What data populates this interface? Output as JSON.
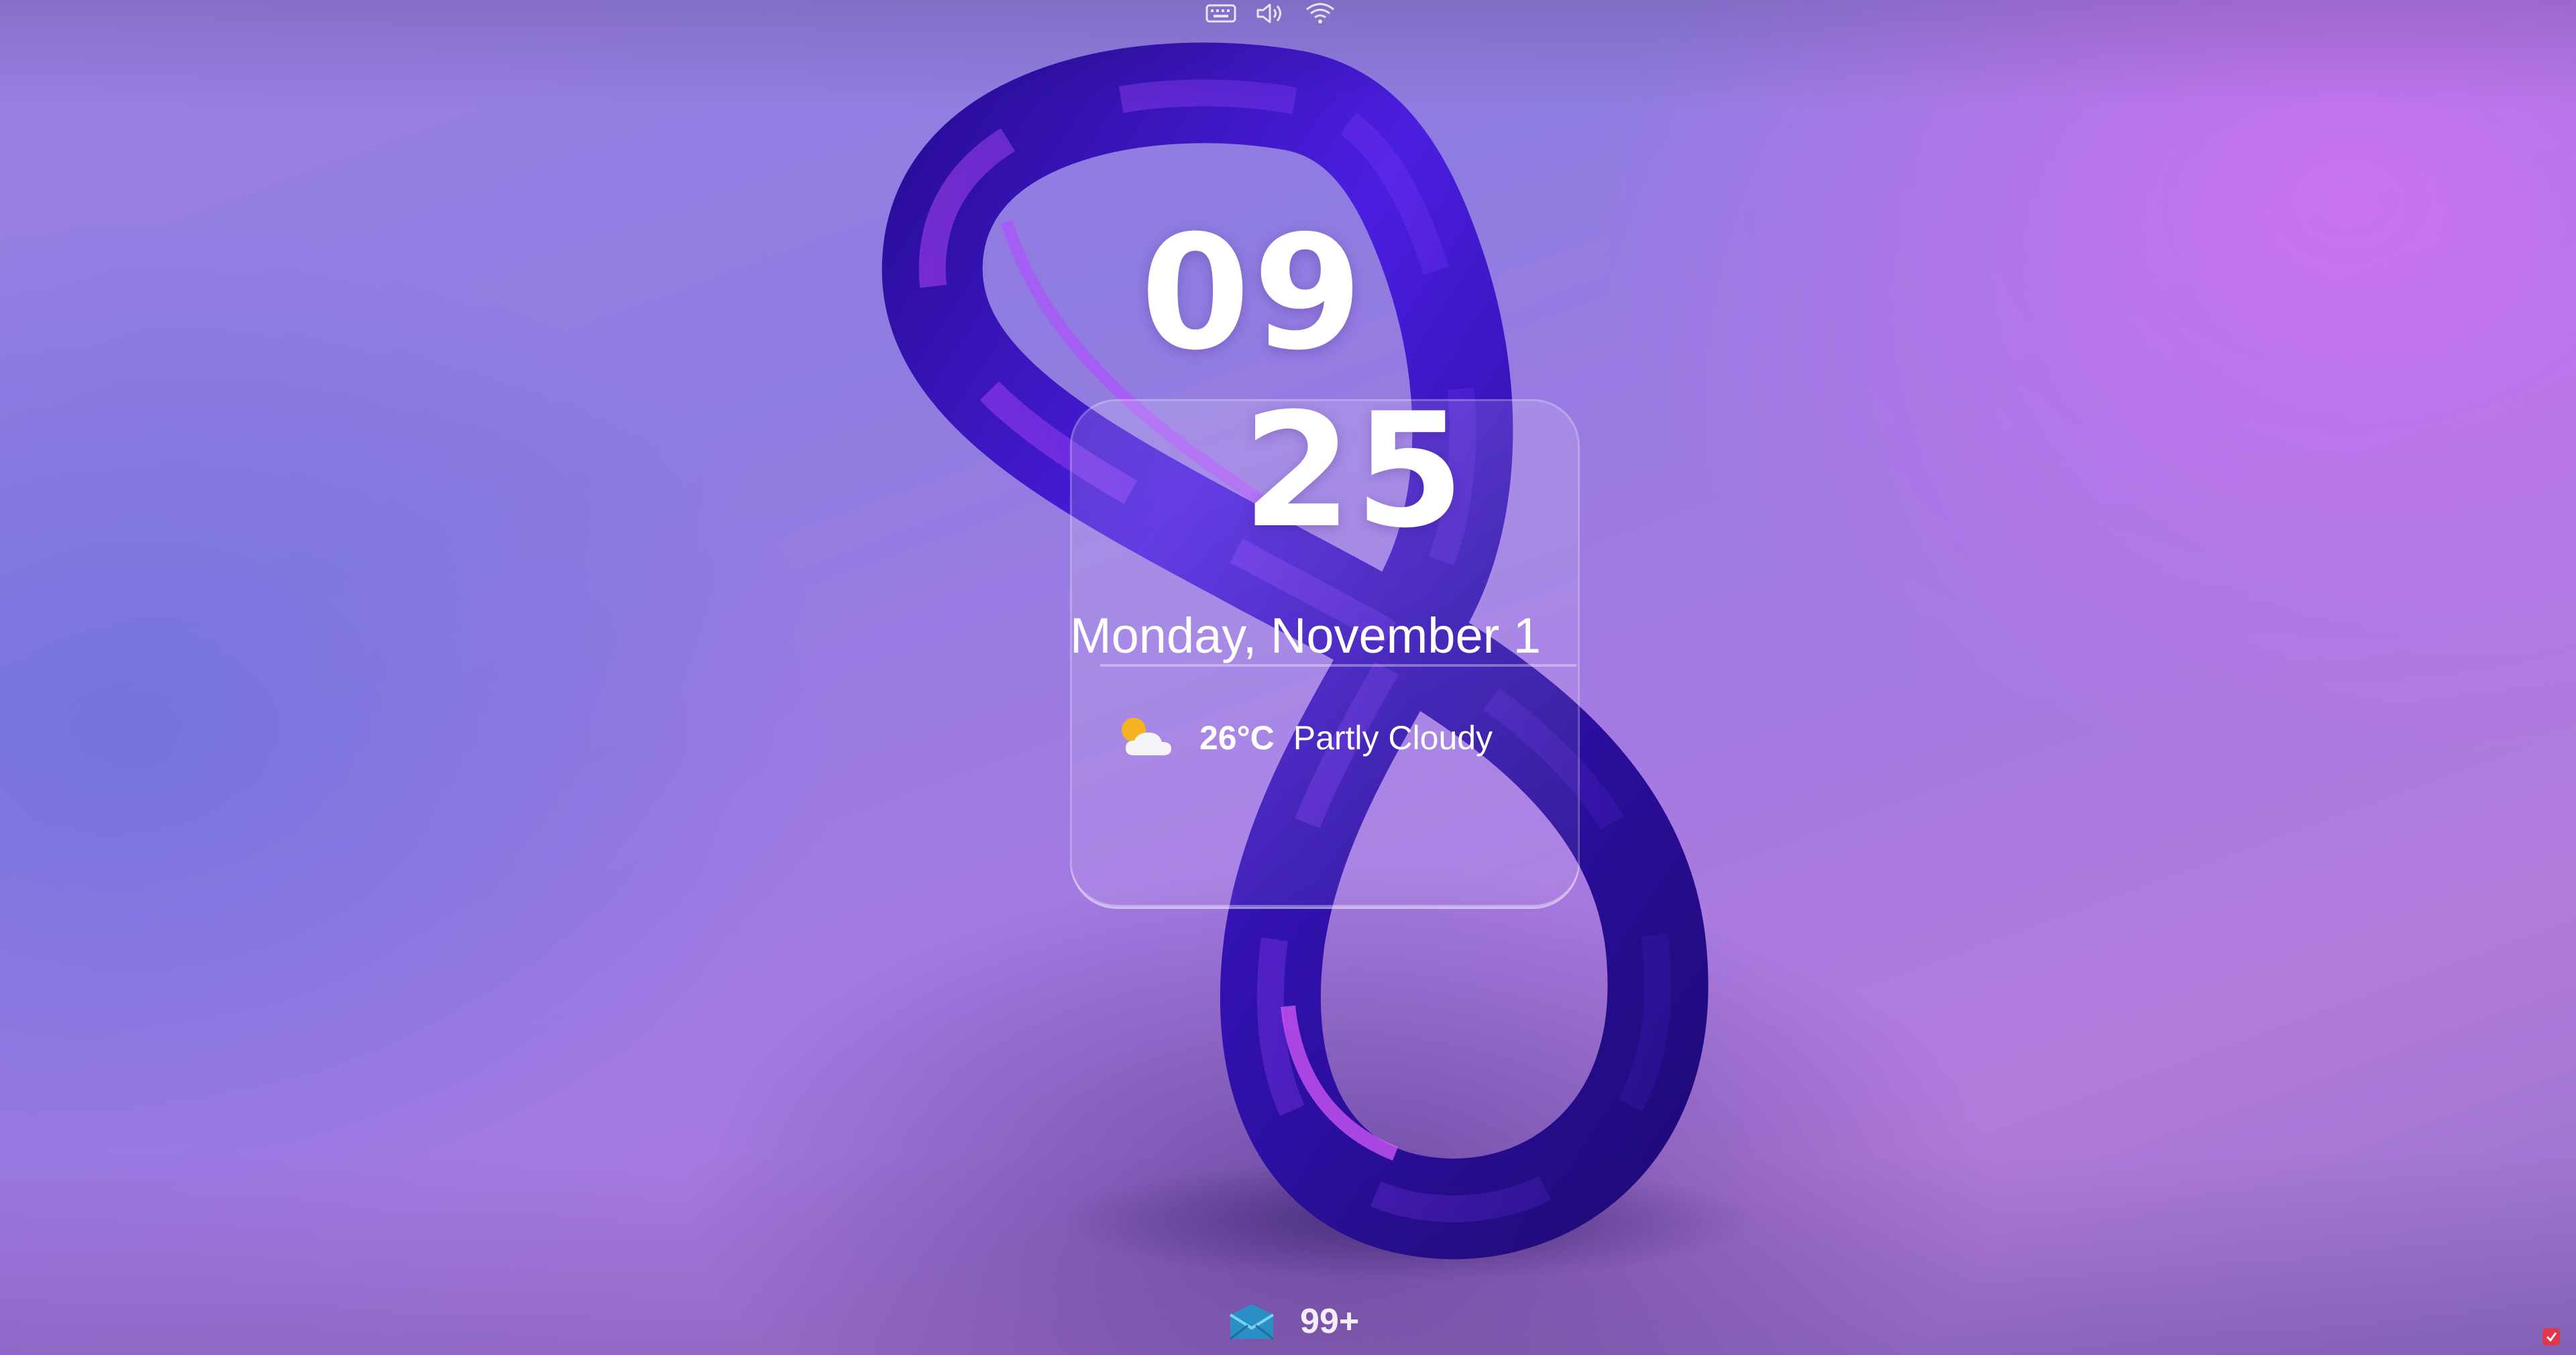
{
  "status_tray": {
    "icons": [
      "keyboard-icon",
      "volume-icon",
      "wifi-icon"
    ]
  },
  "lock_screen": {
    "hour": "09",
    "minute": "25",
    "date": "Monday, November 1"
  },
  "weather": {
    "icon": "partly-cloudy-icon",
    "temperature": "26°C",
    "condition": "Partly Cloudy"
  },
  "notifications": {
    "mail_icon": "mail-icon",
    "mail_count": "99+"
  },
  "colors": {
    "background_start": "#9a7fe4",
    "background_end": "#d06cf0",
    "ribbon": "#3a14b8",
    "text": "#ffffff"
  }
}
